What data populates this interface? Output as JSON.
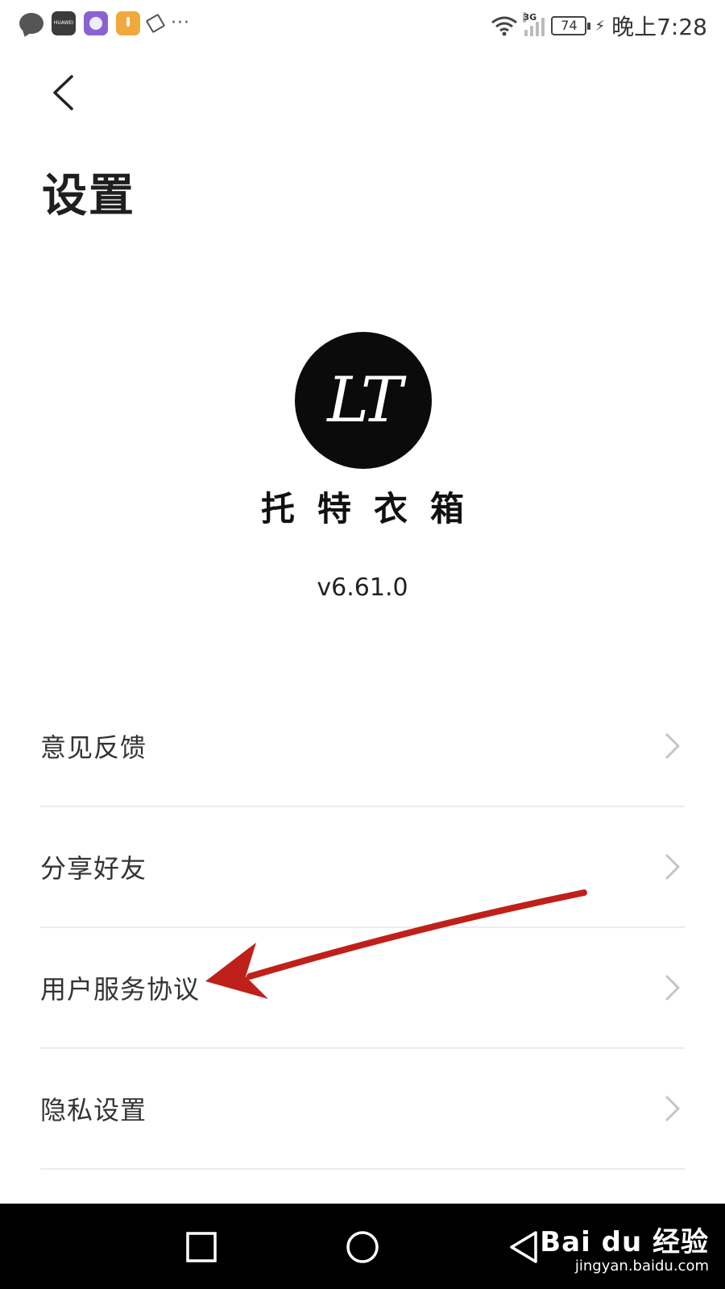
{
  "status_bar": {
    "huawei_label": "HUAWEI",
    "more": "···",
    "network_type": "3G",
    "battery_level": "74",
    "time": "晚上7:28",
    "left_icons": [
      "message-icon",
      "huawei-store-icon",
      "purple-app-icon",
      "orange-app-icon",
      "pin-icon"
    ],
    "right_icons": [
      "wifi-icon",
      "signal-icon",
      "battery-icon",
      "charging-icon"
    ]
  },
  "header": {
    "back_icon": "chevron-left-icon",
    "title": "设置"
  },
  "brand": {
    "logo_text": "LT",
    "name": "托特衣箱",
    "version": "v6.61.0"
  },
  "menu": {
    "items": [
      {
        "label": "意见反馈"
      },
      {
        "label": "分享好友"
      },
      {
        "label": "用户服务协议"
      },
      {
        "label": "隐私设置"
      }
    ]
  },
  "nav_bar": {
    "buttons": [
      "recent-apps-icon",
      "home-icon",
      "back-triangle-icon"
    ],
    "watermark_top": "Bai du 经验",
    "watermark_bottom": "jingyan.baidu.com"
  },
  "colors": {
    "annotation_arrow": "#c0201a",
    "logo_bg": "#0b0b0b",
    "divider": "#ececec",
    "nav_bg": "#000000"
  }
}
